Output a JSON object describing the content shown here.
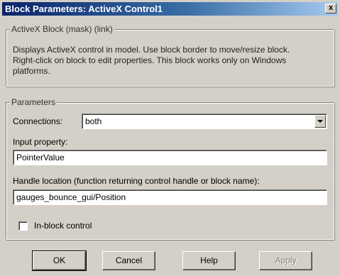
{
  "window": {
    "title": "Block Parameters: ActiveX Control1",
    "close_glyph": "x"
  },
  "mask": {
    "legend": "ActiveX Block (mask) (link)",
    "description": "Displays ActiveX control in model. Use border to move/resize block. Right-click on block to edit properties. This block works only on Windows platforms."
  },
  "parameters": {
    "legend": "Parameters",
    "connections_label": "Connections:",
    "connections_value": "both",
    "input_property_label": "Input property:",
    "input_property_value": "PointerValue",
    "handle_location_label": "Handle location (function returning control handle or block name):",
    "handle_location_value": "gauges_bounce_gui/Position",
    "inblock_label": "In-block control",
    "inblock_checked": false
  },
  "buttons": {
    "ok": "OK",
    "cancel": "Cancel",
    "help": "Help",
    "apply": "Apply"
  }
}
